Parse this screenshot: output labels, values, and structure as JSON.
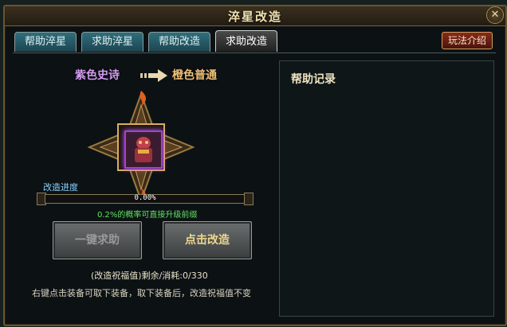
{
  "window": {
    "title": "淬星改造",
    "close_glyph": "✕"
  },
  "tabs": [
    {
      "label": "帮助淬星",
      "active": false
    },
    {
      "label": "求助淬星",
      "active": false
    },
    {
      "label": "帮助改造",
      "active": false
    },
    {
      "label": "求助改造",
      "active": true
    }
  ],
  "guide_button": {
    "label": "玩法介绍"
  },
  "upgrade": {
    "from": "紫色史诗",
    "to": "橙色普通",
    "from_color": "#d39cf0",
    "to_color": "#f0c078"
  },
  "equipment": {
    "icon": "purple-epic-chest-armor-icon",
    "border_color": "#a83ed8"
  },
  "progress": {
    "label": "改造进度",
    "value": 0.0,
    "text": "0.00%",
    "chance_note": "0.2%的概率可直接升级前缀"
  },
  "buttons": {
    "help_label": "一键求助",
    "forge_label": "点击改造"
  },
  "blessing": {
    "text": "(改造祝福值)剩余/消耗:0/330"
  },
  "hint": {
    "text": "右键点击装备可取下装备，取下装备后，改造祝福值不变"
  },
  "record_panel": {
    "title": "帮助记录"
  },
  "colors": {
    "accent_gold": "#c8a060",
    "tab_active": "#303030",
    "tab_inactive": "#2f6f7c",
    "note_green": "#60e060"
  }
}
